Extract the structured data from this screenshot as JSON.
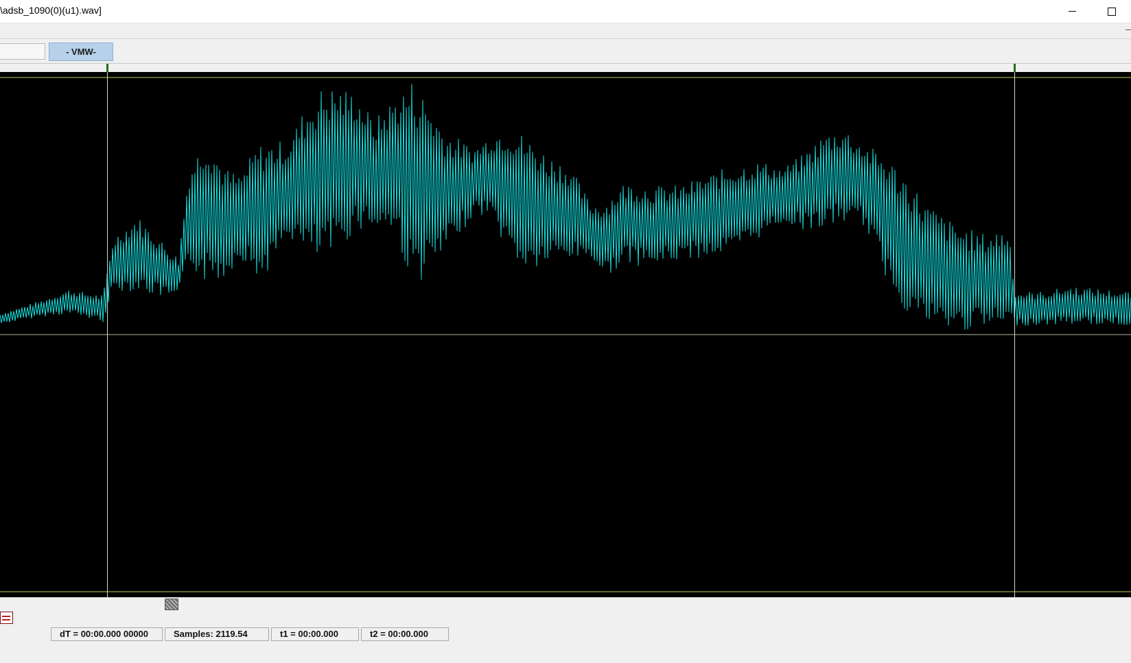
{
  "window": {
    "title": "\\adsb_1090(0)(u1).wav]"
  },
  "toolbar": {
    "mode_button_label": "- VMW-"
  },
  "scope": {
    "trace_color": "#16e0e0",
    "background_color": "#000000",
    "cursor_line_color": "#d8d8c8",
    "limit_line_color": "#c8c860"
  },
  "status": {
    "cells": [
      {
        "label": "dT = 00:00.000 00000"
      },
      {
        "label": "Samples: 2119.54"
      },
      {
        "label": "t1 = 00:00.000"
      },
      {
        "label": "t2 = 00:00.000"
      }
    ]
  },
  "icons": {
    "minimize": "minimize-icon",
    "maximize": "maximize-icon",
    "tool": "spectrum-tool-icon"
  }
}
